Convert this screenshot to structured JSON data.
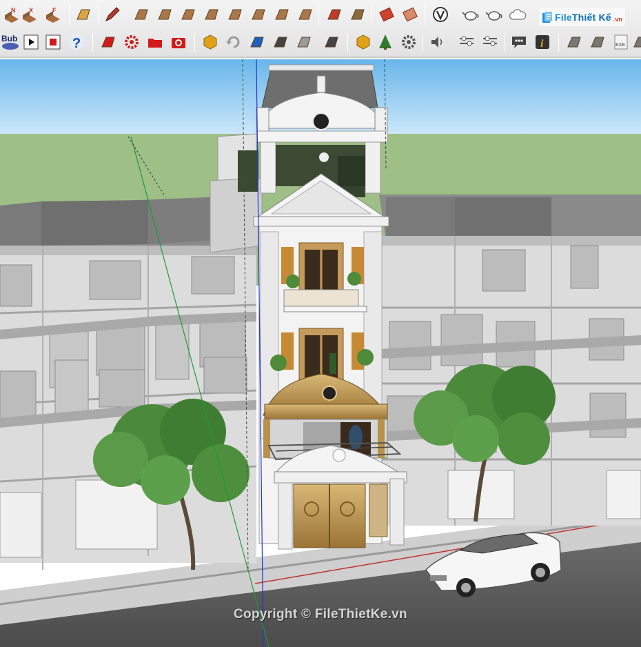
{
  "toolbar": {
    "row1": [
      {
        "name": "add-location-n-icon",
        "glyph": "N",
        "color": "#c0392b"
      },
      {
        "name": "add-location-x-icon",
        "glyph": "X",
        "color": "#c0392b"
      },
      {
        "name": "add-location-f-icon",
        "glyph": "F",
        "color": "#c0392b"
      },
      {
        "name": "curve-tool-icon",
        "glyph": "",
        "color": "#d9a441"
      },
      {
        "name": "pencil-tool-icon",
        "glyph": "",
        "color": "#b23a2e"
      },
      {
        "name": "sandbox-from-contours-icon",
        "glyph": "",
        "color": "#a9774a"
      },
      {
        "name": "sandbox-from-scratch-icon",
        "glyph": "",
        "color": "#a9774a"
      },
      {
        "name": "smoove-icon",
        "glyph": "",
        "color": "#a9774a"
      },
      {
        "name": "stamp-icon",
        "glyph": "",
        "color": "#a9774a"
      },
      {
        "name": "drape-icon",
        "glyph": "",
        "color": "#a9774a"
      },
      {
        "name": "add-detail-icon",
        "glyph": "",
        "color": "#a9774a"
      },
      {
        "name": "flip-edge-icon",
        "glyph": "",
        "color": "#a9774a"
      },
      {
        "name": "terrain-icon",
        "glyph": "",
        "color": "#a9774a"
      },
      {
        "name": "add-location-icon",
        "glyph": "",
        "color": "#c0392b"
      },
      {
        "name": "toggle-terrain-icon",
        "glyph": "",
        "color": "#8b6b3d"
      },
      {
        "name": "photo-texture-icon",
        "glyph": "",
        "color": "#d0402f"
      },
      {
        "name": "eraser-icon",
        "glyph": "",
        "color": "#d98b6a"
      },
      {
        "name": "vray-icon",
        "glyph": "V",
        "color": "#333333"
      },
      {
        "name": "teapot-render-icon",
        "glyph": "",
        "color": "#555555"
      },
      {
        "name": "interactive-render-icon",
        "glyph": "",
        "color": "#555555"
      },
      {
        "name": "cloud-render-icon",
        "glyph": "",
        "color": "#888888"
      }
    ],
    "row2": [
      {
        "name": "bub-logo-icon",
        "glyph": "Bub",
        "color": "#1b2a6e"
      },
      {
        "name": "play-icon",
        "glyph": "",
        "color": "#111111"
      },
      {
        "name": "stop-icon",
        "glyph": "",
        "color": "#d11a1a"
      },
      {
        "name": "help-icon",
        "glyph": "?",
        "color": "#1b4fb5"
      },
      {
        "name": "infinite-light-icon",
        "glyph": "",
        "color": "#d11a1a"
      },
      {
        "name": "settings-gear-icon",
        "glyph": "",
        "color": "#d11a1a"
      },
      {
        "name": "open-folder-icon",
        "glyph": "",
        "color": "#d11a1a"
      },
      {
        "name": "camera-icon",
        "glyph": "",
        "color": "#d11a1a"
      },
      {
        "name": "vray-asset-editor-icon",
        "glyph": "",
        "color": "#e0a21a"
      },
      {
        "name": "refresh-icon",
        "glyph": "",
        "color": "#9a9a9a"
      },
      {
        "name": "render-region-icon",
        "glyph": "",
        "color": "#1f5fbf"
      },
      {
        "name": "video-camera-icon",
        "glyph": "",
        "color": "#444444"
      },
      {
        "name": "frame-buffer-icon",
        "glyph": "",
        "color": "#9a9a9a"
      },
      {
        "name": "vr-headset-icon",
        "glyph": "",
        "color": "#444444"
      },
      {
        "name": "vray-light-icon",
        "glyph": "",
        "color": "#e0a21a"
      },
      {
        "name": "tree-proxy-icon",
        "glyph": "",
        "color": "#2f7a32"
      },
      {
        "name": "grid-gear-icon",
        "glyph": "",
        "color": "#555555"
      },
      {
        "name": "speaker-icon",
        "glyph": "",
        "color": "#555555"
      },
      {
        "name": "sliders-icon",
        "glyph": "",
        "color": "#555555"
      },
      {
        "name": "sliders-eye-icon",
        "glyph": "",
        "color": "#555555"
      },
      {
        "name": "speech-bubble-icon",
        "glyph": "",
        "color": "#444444"
      },
      {
        "name": "info-icon",
        "glyph": "i",
        "color": "#e0a21a"
      },
      {
        "name": "export-icon",
        "glyph": "",
        "color": "#777777"
      },
      {
        "name": "import-star-icon",
        "glyph": "",
        "color": "#777777"
      },
      {
        "name": "exe-file-icon",
        "glyph": "EXE",
        "color": "#777777"
      },
      {
        "name": "file-icon",
        "glyph": "",
        "color": "#777777"
      }
    ]
  },
  "logo": {
    "text_a": "File",
    "text_b": "Thiết Kế",
    "domain": ".vn",
    "color": "#1f8fd8"
  },
  "scene": {
    "sky_top": "#68b6ea",
    "sky_bottom": "#cfe9fa",
    "ground": "#9ebf85",
    "building_gray": "#dcdcdc",
    "roof_gray": "#777777",
    "road": "#5d5d5d",
    "sidewalk": "#cfcfcf",
    "tree_green": "#4a8a3a",
    "gold": "#b8924a"
  },
  "copyright": "Copyright © FileThietKe.vn"
}
